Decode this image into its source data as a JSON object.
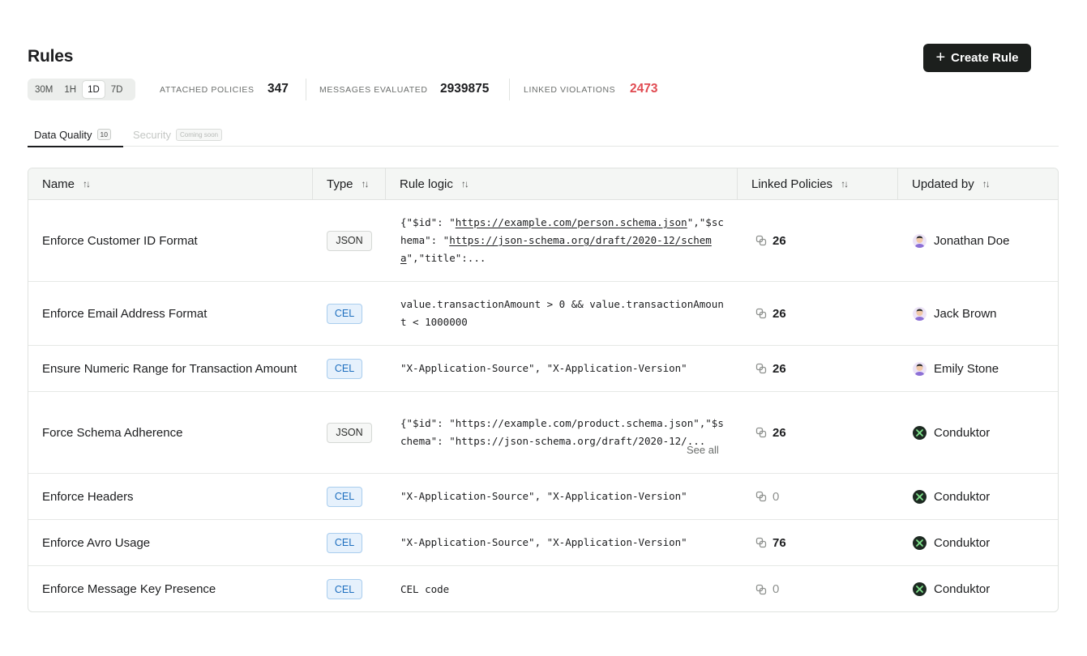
{
  "page": {
    "title": "Rules",
    "create_button": "Create Rule"
  },
  "time_range": {
    "options": [
      "30M",
      "1H",
      "1D",
      "7D"
    ],
    "selected": "1D"
  },
  "stats": {
    "attached_policies": {
      "label": "ATTACHED POLICIES",
      "value": "347"
    },
    "messages_evaluated": {
      "label": "MESSAGES EVALUATED",
      "value": "2939875"
    },
    "linked_violations": {
      "label": "LINKED VIOLATIONS",
      "value": "2473",
      "color": "#e04b52"
    }
  },
  "tabs": [
    {
      "label": "Data Quality",
      "count": "10",
      "active": true
    },
    {
      "label": "Security",
      "badge": "Coming soon",
      "disabled": true
    }
  ],
  "table": {
    "columns": [
      "Name",
      "Type",
      "Rule logic",
      "Linked Policies",
      "Updated by"
    ],
    "see_all_label": "See all",
    "rows": [
      {
        "name": "Enforce Customer ID Format",
        "type": "JSON",
        "logic": "{\"$id\": \"https://example.com/person.schema.json\",\"$schema\": \"https://json-schema.org/draft/2020-12/schema\",\"title\":...",
        "linked_policies": "26",
        "updated_by": "Jonathan Doe",
        "avatar": "person"
      },
      {
        "name": "Enforce Email Address Format",
        "type": "CEL",
        "logic": "value.transactionAmount > 0 && value.transactionAmount < 1000000",
        "linked_policies": "26",
        "updated_by": "Jack Brown",
        "avatar": "person"
      },
      {
        "name": "Ensure Numeric Range for Transaction Amount",
        "type": "CEL",
        "logic": "\"X-Application-Source\", \"X-Application-Version\"",
        "linked_policies": "26",
        "updated_by": "Emily Stone",
        "avatar": "person"
      },
      {
        "name": "Force Schema Adherence",
        "type": "JSON",
        "logic": "{\"$id\": \"https://example.com/product.schema.json\",\"$schema\": \"https://json-schema.org/draft/2020-12/...",
        "linked_policies": "26",
        "updated_by": "Conduktor",
        "avatar": "logo"
      },
      {
        "name": "Enforce Headers",
        "type": "CEL",
        "logic": "\"X-Application-Source\", \"X-Application-Version\"",
        "linked_policies": "0",
        "updated_by": "Conduktor",
        "avatar": "logo"
      },
      {
        "name": "Enforce Avro Usage",
        "type": "CEL",
        "logic": "\"X-Application-Source\", \"X-Application-Version\"",
        "linked_policies": "76",
        "updated_by": "Conduktor",
        "avatar": "logo"
      },
      {
        "name": "Enforce Message Key Presence",
        "type": "CEL",
        "logic": "CEL code",
        "linked_policies": "0",
        "updated_by": "Conduktor",
        "avatar": "logo"
      }
    ]
  },
  "colors": {
    "primary_button": "#1c1f1d",
    "cel_badge": "#1e6fbf",
    "violations": "#e04b52"
  }
}
